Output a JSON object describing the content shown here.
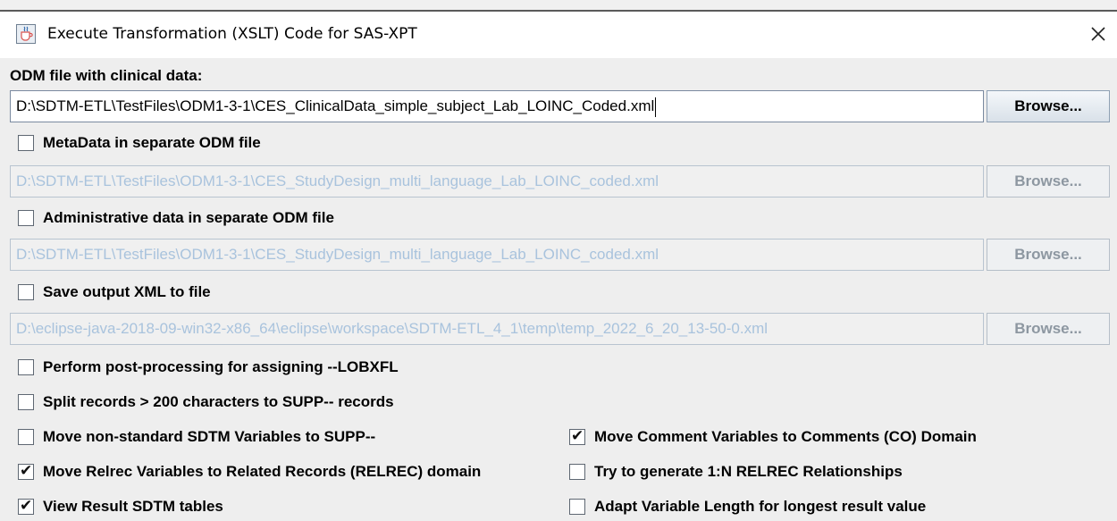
{
  "window": {
    "title": "Execute Transformation (XSLT) Code for SAS-XPT",
    "app_icon": "java-cup-icon",
    "close_icon": "close-icon"
  },
  "clinical": {
    "label": "ODM file with clinical data:",
    "path": "D:\\SDTM-ETL\\TestFiles\\ODM1-3-1\\CES_ClinicalData_simple_subject_Lab_LOINC_Coded.xml",
    "browse": "Browse..."
  },
  "metadata": {
    "checkbox_label": "MetaData in separate ODM file",
    "checked": false,
    "path": "D:\\SDTM-ETL\\TestFiles\\ODM1-3-1\\CES_StudyDesign_multi_language_Lab_LOINC_coded.xml",
    "browse": "Browse..."
  },
  "admin": {
    "checkbox_label": "Administrative data in separate ODM file",
    "checked": false,
    "path": "D:\\SDTM-ETL\\TestFiles\\ODM1-3-1\\CES_StudyDesign_multi_language_Lab_LOINC_coded.xml",
    "browse": "Browse..."
  },
  "output": {
    "checkbox_label": "Save output XML to file",
    "checked": false,
    "path": "D:\\eclipse-java-2018-09-win32-x86_64\\eclipse\\workspace\\SDTM-ETL_4_1\\temp\\temp_2022_6_20_13-50-0.xml",
    "browse": "Browse..."
  },
  "options": {
    "postprocess": {
      "label": "Perform post-processing for assigning --LOBXFL",
      "checked": false
    },
    "split": {
      "label": "Split records > 200 characters to SUPP-- records",
      "checked": false
    },
    "nonstandard": {
      "label": "Move non-standard SDTM Variables to SUPP--",
      "checked": false
    },
    "comment": {
      "label": "Move Comment Variables to Comments (CO) Domain",
      "checked": true
    },
    "relrec": {
      "label": "Move Relrec Variables to Related Records (RELREC) domain",
      "checked": true
    },
    "relrec1n": {
      "label": "Try to generate 1:N RELREC Relationships",
      "checked": false
    },
    "viewresult": {
      "label": "View Result SDTM tables",
      "checked": true
    },
    "adaptlength": {
      "label": "Adapt Variable Length for longest result value",
      "checked": false
    }
  }
}
